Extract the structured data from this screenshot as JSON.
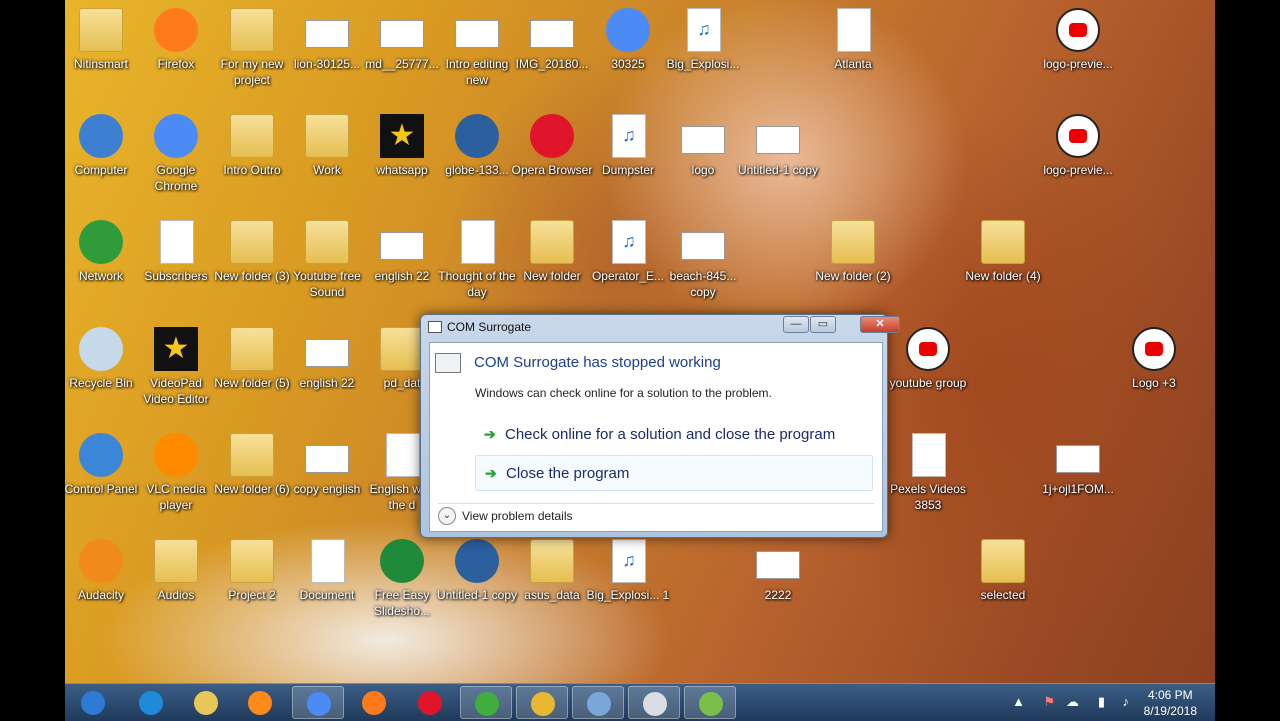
{
  "desktop": {
    "icons": [
      {
        "label": "Nitinsmart",
        "kind": "folder",
        "icon": "user-folder-icon"
      },
      {
        "label": "Firefox",
        "kind": "app",
        "icon": "firefox-icon",
        "color": "#ff7a1a"
      },
      {
        "label": "For my new project",
        "kind": "folder",
        "icon": "folder-icon"
      },
      {
        "label": "lion-30125...",
        "kind": "thumb",
        "icon": "image-thumbnail-icon"
      },
      {
        "label": "md__25777...",
        "kind": "thumb",
        "icon": "image-thumbnail-icon"
      },
      {
        "label": "Intro editing new",
        "kind": "thumb",
        "icon": "image-thumbnail-icon"
      },
      {
        "label": "IMG_20180...",
        "kind": "thumb",
        "icon": "image-thumbnail-icon"
      },
      {
        "label": "30325",
        "kind": "app",
        "icon": "chrome-icon",
        "color": "#4c8bf5"
      },
      {
        "label": "Big_Explosi...",
        "kind": "mp3",
        "icon": "mp3-icon"
      },
      {
        "label": "Atlanta",
        "kind": "doc",
        "icon": "avi-icon"
      },
      {
        "label": "logo-previe...",
        "kind": "yt",
        "icon": "youtube-logo-icon"
      },
      {
        "label": "Computer",
        "kind": "app",
        "icon": "computer-icon",
        "color": "#3d7fd0"
      },
      {
        "label": "Google Chrome",
        "kind": "app",
        "icon": "chrome-icon",
        "color": "#4c8bf5"
      },
      {
        "label": "Intro Outro",
        "kind": "folder",
        "icon": "folder-icon"
      },
      {
        "label": "Work",
        "kind": "folder",
        "icon": "folder-icon"
      },
      {
        "label": "whatsapp",
        "kind": "dark",
        "icon": "star-video-icon"
      },
      {
        "label": "globe-133...",
        "kind": "app",
        "icon": "globe-icon",
        "color": "#2b5f9e"
      },
      {
        "label": "Opera Browser",
        "kind": "app",
        "icon": "opera-icon",
        "color": "#e0142b"
      },
      {
        "label": "Dumpster",
        "kind": "mp3",
        "icon": "mp3-icon"
      },
      {
        "label": "logo",
        "kind": "thumb",
        "icon": "image-thumbnail-icon"
      },
      {
        "label": "Untitled-1 copy",
        "kind": "thumb",
        "icon": "image-thumbnail-icon"
      },
      {
        "label": "logo-previe...",
        "kind": "yt",
        "icon": "youtube-logo-icon"
      },
      {
        "label": "Network",
        "kind": "app",
        "icon": "network-icon",
        "color": "#2f9b3b"
      },
      {
        "label": "Subscribers",
        "kind": "doc",
        "icon": "document-icon"
      },
      {
        "label": "New folder (3)",
        "kind": "folder",
        "icon": "folder-icon"
      },
      {
        "label": "Youtube free Sound",
        "kind": "folder",
        "icon": "folder-icon"
      },
      {
        "label": "english 22",
        "kind": "thumb",
        "icon": "image-thumbnail-icon"
      },
      {
        "label": "Thought of the day",
        "kind": "doc",
        "icon": "document-icon"
      },
      {
        "label": "New folder",
        "kind": "folder",
        "icon": "folder-icon"
      },
      {
        "label": "Operator_E...",
        "kind": "mp3",
        "icon": "mp3-icon"
      },
      {
        "label": "beach-845... copy",
        "kind": "thumb",
        "icon": "image-thumbnail-icon"
      },
      {
        "label": "New folder (2)",
        "kind": "folder",
        "icon": "folder-icon"
      },
      {
        "label": "New folder (4)",
        "kind": "folder",
        "icon": "folder-icon"
      },
      {
        "label": "Recycle Bin",
        "kind": "app",
        "icon": "recycle-bin-icon",
        "color": "#c6d9ea"
      },
      {
        "label": "VideoPad Video Editor",
        "kind": "dark",
        "icon": "star-video-icon"
      },
      {
        "label": "New folder (5)",
        "kind": "folder",
        "icon": "folder-icon"
      },
      {
        "label": "english 22",
        "kind": "thumb",
        "icon": "image-thumbnail-icon"
      },
      {
        "label": "pd_dat",
        "kind": "folder",
        "icon": "folder-icon"
      },
      {
        "label": "youtube group",
        "kind": "yt",
        "icon": "youtube-logo-icon"
      },
      {
        "label": "Logo +3",
        "kind": "yt",
        "icon": "youtube-logo-icon"
      },
      {
        "label": "Control Panel",
        "kind": "app",
        "icon": "control-panel-icon",
        "color": "#3b86d6"
      },
      {
        "label": "VLC media player",
        "kind": "app",
        "icon": "vlc-cone-icon",
        "color": "#ff8a00"
      },
      {
        "label": "New folder (6)",
        "kind": "folder",
        "icon": "folder-icon"
      },
      {
        "label": "copy english",
        "kind": "thumb",
        "icon": "image-thumbnail-icon"
      },
      {
        "label": "English w of the d",
        "kind": "doc",
        "icon": "document-icon"
      },
      {
        "label": "Pexels Videos 3853",
        "kind": "doc",
        "icon": "video-file-icon"
      },
      {
        "label": "1j+ojl1FOM...",
        "kind": "thumb",
        "icon": "image-thumbnail-icon"
      },
      {
        "label": "Audacity",
        "kind": "app",
        "icon": "audacity-icon",
        "color": "#f08a1a"
      },
      {
        "label": "Audios",
        "kind": "folder",
        "icon": "folder-icon"
      },
      {
        "label": "Project 2",
        "kind": "folder",
        "icon": "folder-icon"
      },
      {
        "label": "Document",
        "kind": "doc",
        "icon": "document-icon"
      },
      {
        "label": "Free Easy Slidesho...",
        "kind": "app",
        "icon": "slideshow-app-icon",
        "color": "#1e8a3a"
      },
      {
        "label": "Untitled-1 copy",
        "kind": "app",
        "icon": "globe-icon",
        "color": "#2b5f9e"
      },
      {
        "label": "asus_data",
        "kind": "folder",
        "icon": "folder-icon"
      },
      {
        "label": "Big_Explosi... 1",
        "kind": "mp3",
        "icon": "mp3-icon"
      },
      {
        "label": "2222",
        "kind": "thumb",
        "icon": "image-thumbnail-icon"
      },
      {
        "label": "selected",
        "kind": "folder",
        "icon": "folder-icon"
      }
    ]
  },
  "dialog": {
    "title": "COM Surrogate",
    "heading": "COM Surrogate has stopped working",
    "description": "Windows can check online for a solution to the problem.",
    "option_1": "Check online for a solution and close the program",
    "option_2": "Close the program",
    "details": "View problem details",
    "arrow_glyph": "➔",
    "chevron_glyph": "⌄",
    "minimize_glyph": "—",
    "maximize_glyph": "▭",
    "close_glyph": "✕"
  },
  "taskbar": {
    "apps": [
      {
        "icon": "start-orb-icon",
        "color": "#2d7bd4"
      },
      {
        "icon": "internet-explorer-icon",
        "color": "#1f8ad8"
      },
      {
        "icon": "file-explorer-icon",
        "color": "#e7c65a"
      },
      {
        "icon": "media-player-icon",
        "color": "#ff8a1a"
      },
      {
        "icon": "chrome-icon",
        "color": "#4c8bf5",
        "active": true
      },
      {
        "icon": "firefox-icon",
        "color": "#ff7a1a"
      },
      {
        "icon": "opera-icon",
        "color": "#e0142b"
      },
      {
        "icon": "utorrent-icon",
        "color": "#3fae3c",
        "active": true
      },
      {
        "icon": "video-editor-icon",
        "color": "#e8b832",
        "active": true
      },
      {
        "icon": "image-editor-icon",
        "color": "#7aa6d8",
        "active": true
      },
      {
        "icon": "com-surrogate-icon",
        "color": "#d9dde3",
        "active": true
      },
      {
        "icon": "sheets-icon",
        "color": "#7bbf4a",
        "active": true
      }
    ],
    "time": "4:06 PM",
    "date": "8/19/2018"
  }
}
